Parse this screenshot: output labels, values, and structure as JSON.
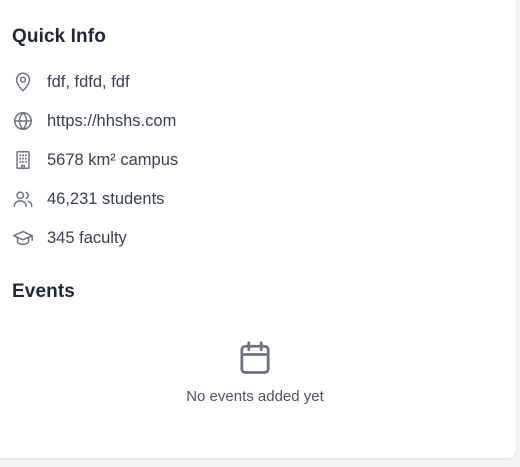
{
  "quick_info": {
    "title": "Quick Info",
    "items": [
      {
        "icon": "location-pin-icon",
        "text": "fdf, fdfd, fdf"
      },
      {
        "icon": "globe-icon",
        "text": "https://hhshs.com"
      },
      {
        "icon": "building-icon",
        "text": "5678 km² campus"
      },
      {
        "icon": "users-icon",
        "text": "46,231 students"
      },
      {
        "icon": "graduation-cap-icon",
        "text": "345 faculty"
      }
    ]
  },
  "events": {
    "title": "Events",
    "empty_icon": "calendar-icon",
    "empty_text": "No events added yet"
  }
}
